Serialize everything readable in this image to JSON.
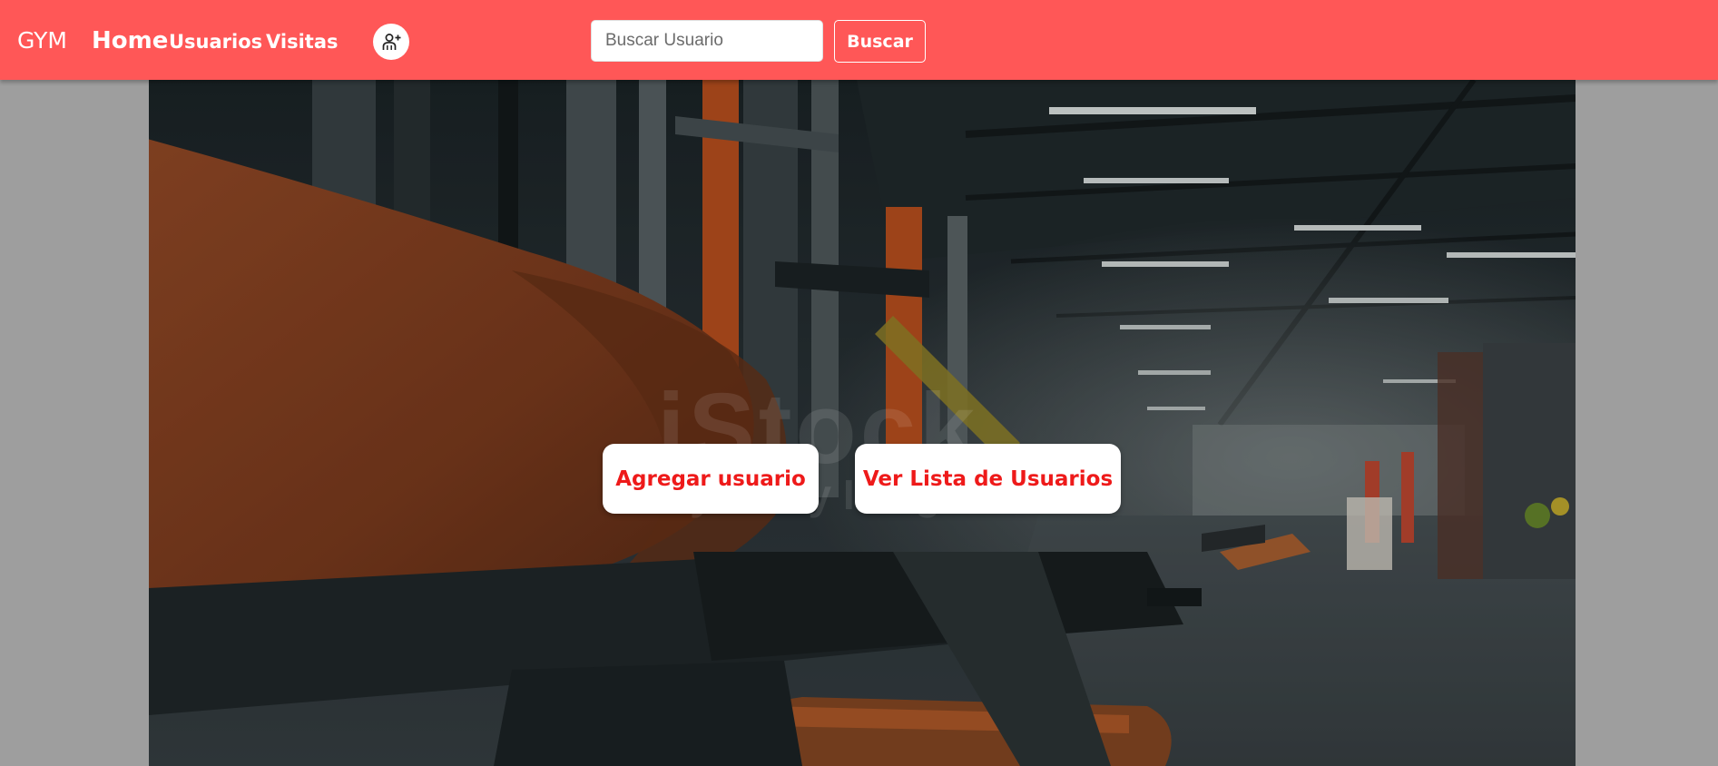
{
  "navbar": {
    "brand": "GYM",
    "links": [
      {
        "label": "Home"
      },
      {
        "label": "Usuarios"
      },
      {
        "label": "Visitas"
      }
    ],
    "add_user_icon": "user-plus-icon",
    "background_color": "#ff5757"
  },
  "search": {
    "placeholder": "Buscar Usuario",
    "value": "",
    "button_label": "Buscar"
  },
  "hero": {
    "image_description_icon": "gym-interior-photo",
    "watermark_line1": "iStock",
    "watermark_line2": "by Getty Images",
    "actions": [
      {
        "label": "Agregar usuario"
      },
      {
        "label": "Ver Lista de Usuarios"
      }
    ],
    "action_text_color": "#ee1a1a"
  }
}
